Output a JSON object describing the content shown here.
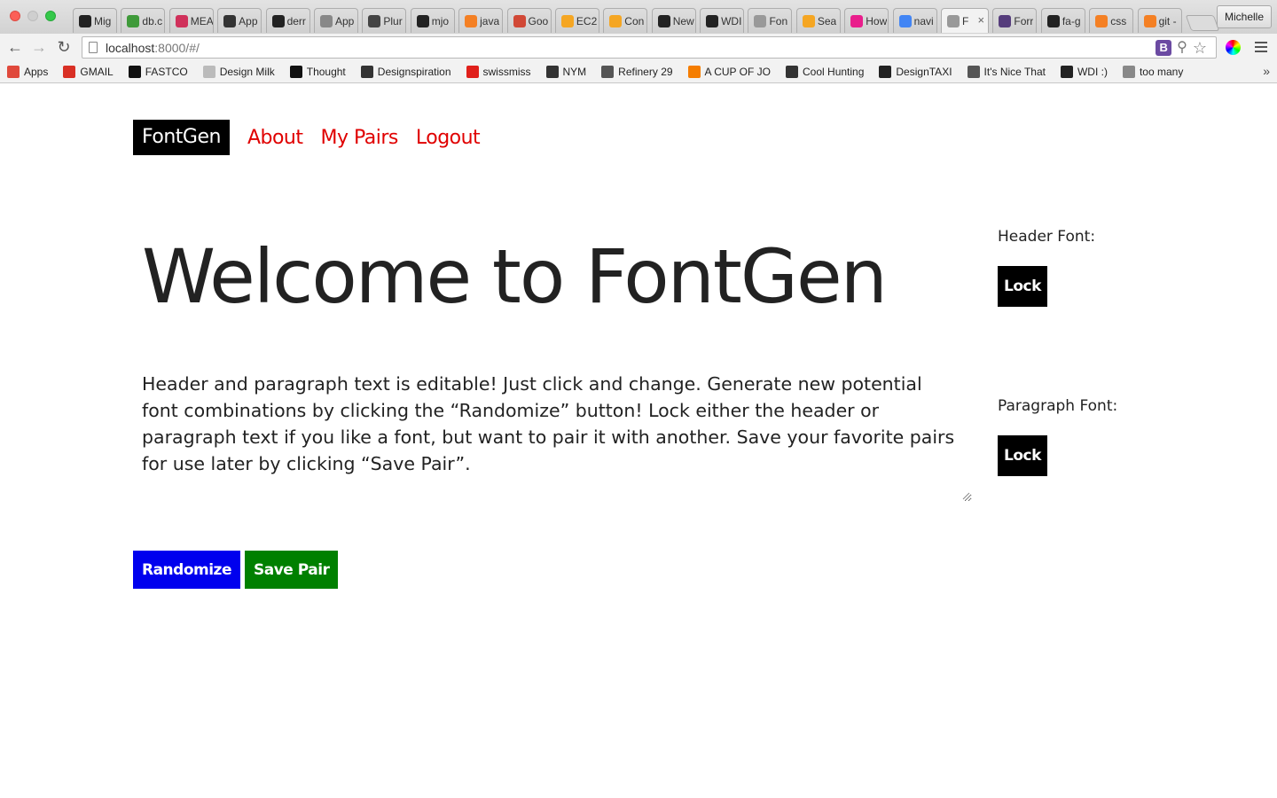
{
  "browser": {
    "tabs": [
      {
        "label": "Mig",
        "icon": "github-icon",
        "color": "#222222"
      },
      {
        "label": "db.c",
        "icon": "mongodb-icon",
        "color": "#3f9a3a"
      },
      {
        "label": "MEA",
        "icon": "slack-icon",
        "color": "#d0315b"
      },
      {
        "label": "App",
        "icon": "plane-icon",
        "color": "#333333"
      },
      {
        "label": "derr",
        "icon": "github-icon",
        "color": "#222222"
      },
      {
        "label": "App",
        "icon": "spark-icon",
        "color": "#888888"
      },
      {
        "label": "Plur",
        "icon": "download-icon",
        "color": "#444444"
      },
      {
        "label": "mjo",
        "icon": "github-icon",
        "color": "#222222"
      },
      {
        "label": "java",
        "icon": "stackoverflow-icon",
        "color": "#f48024"
      },
      {
        "label": "Goo",
        "icon": "google-docs-icon",
        "color": "#d14836"
      },
      {
        "label": "EC2",
        "icon": "aws-icon",
        "color": "#f5a623"
      },
      {
        "label": "Con",
        "icon": "aws-icon",
        "color": "#f5a623"
      },
      {
        "label": "New",
        "icon": "github-icon",
        "color": "#222222"
      },
      {
        "label": "WDI",
        "icon": "github-icon",
        "color": "#222222"
      },
      {
        "label": "Fon",
        "icon": "page-icon",
        "color": "#999999"
      },
      {
        "label": "Sea",
        "icon": "asterisk-icon",
        "color": "#f5a623"
      },
      {
        "label": "How",
        "icon": "pinterest-icon",
        "color": "#e91e8c"
      },
      {
        "label": "navi",
        "icon": "google-icon",
        "color": "#4285f4"
      },
      {
        "label": "F",
        "icon": "page-icon",
        "color": "#999999",
        "active": true
      },
      {
        "label": "Forr",
        "icon": "bootstrap-icon",
        "color": "#563d7c"
      },
      {
        "label": "fa-g",
        "icon": "flag-icon",
        "color": "#222222"
      },
      {
        "label": "css",
        "icon": "stackoverflow-icon",
        "color": "#f48024"
      },
      {
        "label": "git -",
        "icon": "stackoverflow-icon",
        "color": "#f48024"
      }
    ],
    "profile": "Michelle",
    "url_host": "localhost",
    "url_rest": ":8000/#/",
    "bookmarks": [
      {
        "label": "Apps",
        "icon": "apps-grid-icon",
        "color": "#e0493c"
      },
      {
        "label": "GMAIL",
        "icon": "gmail-icon",
        "color": "#d93025"
      },
      {
        "label": "FASTCO",
        "icon": "fastco-icon",
        "color": "#111111"
      },
      {
        "label": "Design Milk",
        "icon": "page-icon",
        "color": "#bbbbbb"
      },
      {
        "label": "Thought",
        "icon": "thought-icon",
        "color": "#111111"
      },
      {
        "label": "Designspiration",
        "icon": "designspiration-icon",
        "color": "#333333"
      },
      {
        "label": "swissmiss",
        "icon": "swiss-cross-icon",
        "color": "#e0201b"
      },
      {
        "label": "NYM",
        "icon": "nym-icon",
        "color": "#333333"
      },
      {
        "label": "Refinery 29",
        "icon": "refinery-icon",
        "color": "#555555"
      },
      {
        "label": "A CUP OF JO",
        "icon": "blogger-icon",
        "color": "#f57d00"
      },
      {
        "label": "Cool Hunting",
        "icon": "ch-icon",
        "color": "#333333"
      },
      {
        "label": "DesignTAXI",
        "icon": "taxi-icon",
        "color": "#222222"
      },
      {
        "label": "It's Nice That",
        "icon": "nicethat-icon",
        "color": "#555555"
      },
      {
        "label": "WDI :)",
        "icon": "github-icon",
        "color": "#222222"
      },
      {
        "label": "too many",
        "icon": "gear-folder-icon",
        "color": "#888888"
      }
    ]
  },
  "site": {
    "brand": "FontGen",
    "nav": [
      "About",
      "My Pairs",
      "Logout"
    ],
    "headline": "Welcome to FontGen",
    "paragraph": "Header and paragraph text is editable! Just click and change. Generate new potential font combinations by clicking the “Randomize” button! Lock either the header or paragraph text if you like a font, but want to pair it with another. Save your favorite pairs for use later by clicking “Save Pair”.",
    "header_font_label": "Header Font:",
    "paragraph_font_label": "Paragraph Font:",
    "lock_label": "Lock",
    "randomize_label": "Randomize",
    "save_pair_label": "Save Pair",
    "colors": {
      "nav_link": "#e00000",
      "randomize": "#0000ee",
      "save_pair": "#008000",
      "brand_bg": "#000000"
    }
  }
}
